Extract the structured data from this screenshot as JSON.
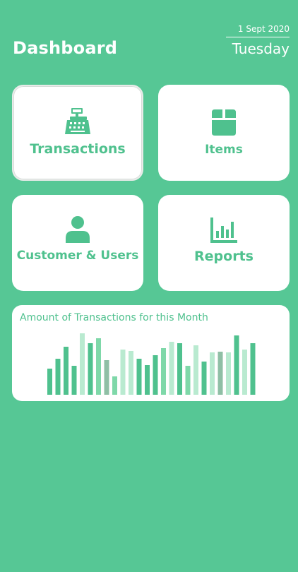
{
  "header": {
    "title": "Dashboard",
    "date": "1 Sept 2020",
    "day": "Tuesday"
  },
  "tiles": {
    "transactions": {
      "label": "Transactions",
      "icon": "cash-register-icon",
      "selected": true
    },
    "items": {
      "label": "Items",
      "icon": "box-icon"
    },
    "customers": {
      "label": "Customer & Users",
      "icon": "user-icon"
    },
    "reports": {
      "label": "Reports",
      "icon": "bar-chart-icon"
    }
  },
  "colors": {
    "background": "#56c795",
    "accent": "#4fc18e",
    "bar_colors": [
      "#4fc18e",
      "#7fd8a9",
      "#b9ead0",
      "#8fbfa5"
    ]
  },
  "chart": {
    "title": "Amount of Transactions for this Month"
  },
  "chart_data": {
    "type": "bar",
    "title": "Amount of Transactions for this Month",
    "values": [
      37,
      51,
      68,
      41,
      87,
      73,
      80,
      49,
      26,
      64,
      62,
      51,
      42,
      56,
      66,
      75,
      73,
      41,
      70,
      47,
      60,
      61,
      60,
      84,
      64,
      73
    ],
    "color_index": [
      0,
      0,
      0,
      0,
      2,
      0,
      1,
      3,
      1,
      2,
      2,
      0,
      0,
      0,
      1,
      2,
      0,
      1,
      2,
      0,
      2,
      3,
      2,
      0,
      2,
      0
    ],
    "ylim": [
      0,
      90
    ],
    "grid": false,
    "axes_visible": false
  }
}
